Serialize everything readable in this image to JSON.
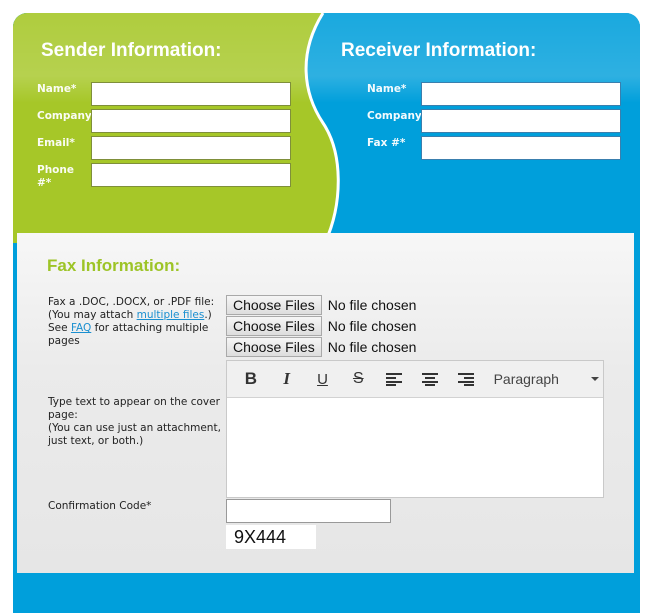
{
  "colors": {
    "sender_green": "#a6c728",
    "receiver_blue": "#009fdb",
    "fax_title_green": "#9dc427",
    "link_blue": "#1a8fd0"
  },
  "sender": {
    "title": "Sender Information:",
    "fields": [
      {
        "label": "Name*",
        "value": ""
      },
      {
        "label": "Company",
        "value": ""
      },
      {
        "label": "Email*",
        "value": ""
      },
      {
        "label": "Phone #*",
        "value": ""
      }
    ]
  },
  "receiver": {
    "title": "Receiver Information:",
    "fields": [
      {
        "label": "Name*",
        "value": ""
      },
      {
        "label": "Company",
        "value": ""
      },
      {
        "label": "Fax #*",
        "value": ""
      }
    ]
  },
  "fax": {
    "title": "Fax Information:",
    "attach_text_1": "Fax a .DOC, .DOCX, or .PDF file:",
    "attach_text_2_prefix": "(You may attach ",
    "attach_link_multiple": "multiple files",
    "attach_text_2_suffix": ".)",
    "attach_text_3_prefix": "See ",
    "attach_link_faq": "FAQ",
    "attach_text_3_suffix": " for attaching multiple pages",
    "file_inputs": [
      {
        "button": "Choose Files",
        "status": "No file chosen"
      },
      {
        "button": "Choose Files",
        "status": "No file chosen"
      },
      {
        "button": "Choose Files",
        "status": "No file chosen"
      }
    ],
    "cover_text_1": "Type text to appear on the cover page:",
    "cover_text_2": "(You can use just an attachment, just text, or both.)",
    "editor": {
      "toolbar": [
        "bold-icon",
        "italic-icon",
        "underline-icon",
        "strikethrough-icon",
        "align-left-icon",
        "align-center-icon",
        "align-right-icon"
      ],
      "bold": "B",
      "italic": "I",
      "underline": "U",
      "strike": "S",
      "format_select": "Paragraph",
      "content": ""
    },
    "confirmation_label": "Confirmation Code*",
    "confirmation_value": "",
    "captcha_code": "9X444"
  }
}
